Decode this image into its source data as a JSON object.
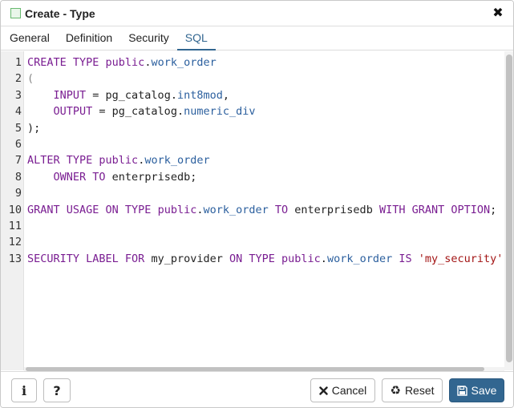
{
  "dialog": {
    "title": "Create - Type",
    "close_label": "✖"
  },
  "tabs": [
    {
      "label": "General",
      "active": false
    },
    {
      "label": "Definition",
      "active": false
    },
    {
      "label": "Security",
      "active": false
    },
    {
      "label": "SQL",
      "active": true
    }
  ],
  "editor": {
    "lines": [
      {
        "n": "1",
        "tokens": [
          {
            "t": "CREATE TYPE",
            "c": "kw"
          },
          {
            "t": " public",
            "c": "kw"
          },
          {
            "t": ".",
            "c": "plain"
          },
          {
            "t": "work_order",
            "c": "fn"
          }
        ]
      },
      {
        "n": "2",
        "tokens": [
          {
            "t": "(",
            "c": "punc"
          }
        ]
      },
      {
        "n": "3",
        "tokens": [
          {
            "t": "    INPUT",
            "c": "kw"
          },
          {
            "t": " = pg_catalog.",
            "c": "plain"
          },
          {
            "t": "int8mod",
            "c": "fn"
          },
          {
            "t": ",",
            "c": "plain"
          }
        ]
      },
      {
        "n": "4",
        "tokens": [
          {
            "t": "    OUTPUT",
            "c": "kw"
          },
          {
            "t": " = pg_catalog.",
            "c": "plain"
          },
          {
            "t": "numeric_div",
            "c": "fn"
          }
        ]
      },
      {
        "n": "5",
        "tokens": [
          {
            "t": ");",
            "c": "plain"
          }
        ]
      },
      {
        "n": "6",
        "tokens": []
      },
      {
        "n": "7",
        "tokens": [
          {
            "t": "ALTER TYPE",
            "c": "kw"
          },
          {
            "t": " public",
            "c": "kw"
          },
          {
            "t": ".",
            "c": "plain"
          },
          {
            "t": "work_order",
            "c": "fn"
          }
        ]
      },
      {
        "n": "8",
        "tokens": [
          {
            "t": "    OWNER TO",
            "c": "kw"
          },
          {
            "t": " enterprisedb;",
            "c": "plain"
          }
        ]
      },
      {
        "n": "9",
        "tokens": []
      },
      {
        "n": "10",
        "tokens": [
          {
            "t": "GRANT USAGE ON TYPE",
            "c": "kw"
          },
          {
            "t": " public",
            "c": "kw"
          },
          {
            "t": ".",
            "c": "plain"
          },
          {
            "t": "work_order",
            "c": "fn"
          },
          {
            "t": " TO",
            "c": "kw"
          },
          {
            "t": " enterprisedb ",
            "c": "plain"
          },
          {
            "t": "WITH GRANT OPTION",
            "c": "kw"
          },
          {
            "t": ";",
            "c": "plain"
          }
        ]
      },
      {
        "n": "11",
        "tokens": []
      },
      {
        "n": "12",
        "tokens": []
      },
      {
        "n": "13",
        "tokens": [
          {
            "t": "SECURITY LABEL FOR",
            "c": "kw"
          },
          {
            "t": " my_provider ",
            "c": "plain"
          },
          {
            "t": "ON TYPE",
            "c": "kw"
          },
          {
            "t": " public",
            "c": "kw"
          },
          {
            "t": ".",
            "c": "plain"
          },
          {
            "t": "work_order",
            "c": "fn"
          },
          {
            "t": " IS",
            "c": "kw"
          },
          {
            "t": " 'my_security'",
            "c": "str"
          }
        ]
      }
    ]
  },
  "footer": {
    "info_label": "i",
    "help_label": "?",
    "cancel_label": "Cancel",
    "reset_label": "Reset",
    "save_label": "Save"
  },
  "colors": {
    "accent": "#326690",
    "keyword": "#7a1e92",
    "identifier": "#2b5f9e",
    "string": "#a31515"
  },
  "icons": {
    "title": "type-icon",
    "close": "close-icon",
    "cancel": "times-icon",
    "reset": "recycle-icon",
    "save": "floppy-disk-icon"
  }
}
